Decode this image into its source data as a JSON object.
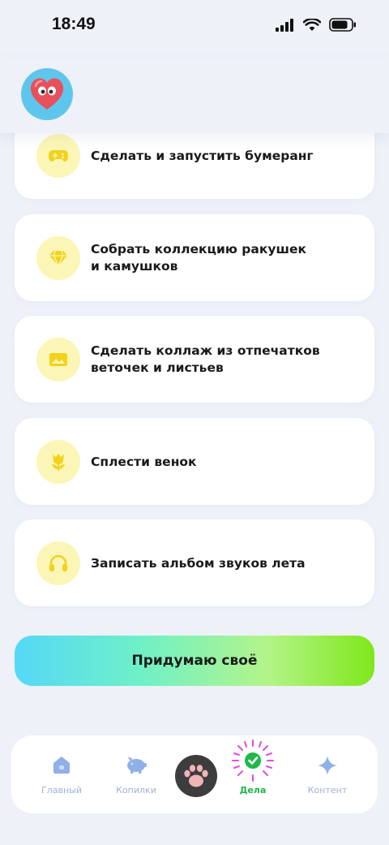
{
  "status_bar": {
    "time": "18:49"
  },
  "tasks": [
    {
      "label": "Сделать и запустить бумеранг",
      "icon": "gamepad-icon"
    },
    {
      "label": "Собрать коллекцию ракушек\nи камушков",
      "icon": "diamond-icon"
    },
    {
      "label": "Сделать коллаж из отпечатков\nветочек и листьев",
      "icon": "image-icon"
    },
    {
      "label": "Сплести венок",
      "icon": "flower-icon"
    },
    {
      "label": "Записать альбом звуков лета",
      "icon": "headphones-icon"
    }
  ],
  "cta": {
    "label": "Придумаю своё"
  },
  "nav": {
    "home": "Главный",
    "piggy": "Копилки",
    "tasks": "Дела",
    "content": "Контент"
  },
  "colors": {
    "icon_bg": "#fbf6b5",
    "icon_fg": "#f2d21c",
    "active_nav": "#1fb84a",
    "inactive_nav": "#9fb2d4"
  }
}
